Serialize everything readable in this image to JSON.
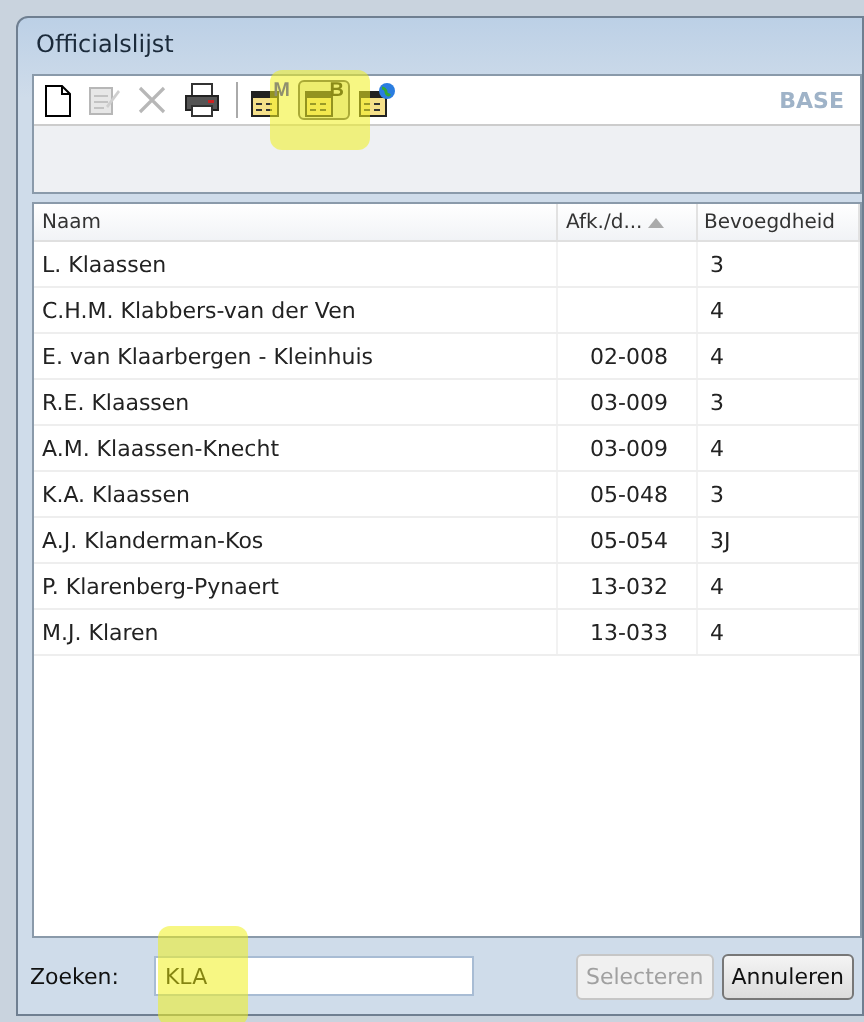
{
  "window": {
    "title": "Officialslijst"
  },
  "toolbar": {
    "buttons": [
      {
        "kind": "new",
        "disabled": false,
        "pressed": false
      },
      {
        "kind": "edit",
        "disabled": true,
        "pressed": false
      },
      {
        "kind": "delete",
        "disabled": true,
        "pressed": false
      },
      {
        "kind": "print",
        "disabled": false,
        "pressed": false
      },
      {
        "kind": "separator"
      },
      {
        "kind": "badge",
        "badge": "M",
        "pressed": false
      },
      {
        "kind": "badge",
        "badge": "B",
        "pressed": true
      },
      {
        "kind": "globe",
        "pressed": false
      }
    ],
    "label": "BASE"
  },
  "table": {
    "columns": [
      {
        "label": "Naam",
        "sorted": false
      },
      {
        "label": "Afk./d...",
        "sorted": true
      },
      {
        "label": "Bevoegdheid",
        "sorted": false
      }
    ],
    "rows": [
      [
        "L. Klaassen",
        "",
        "3"
      ],
      [
        "C.H.M. Klabbers-van der Ven",
        "",
        "4"
      ],
      [
        "E. van Klaarbergen - Kleinhuis",
        "02-008",
        "4"
      ],
      [
        "R.E. Klaassen",
        "03-009",
        "3"
      ],
      [
        "A.M. Klaassen-Knecht",
        "03-009",
        "4"
      ],
      [
        "K.A. Klaassen",
        "05-048",
        "3"
      ],
      [
        "A.J. Klanderman-Kos",
        "05-054",
        "3J"
      ],
      [
        "P. Klarenberg-Pynaert",
        "13-032",
        "4"
      ],
      [
        "M.J. Klaren",
        "13-033",
        "4"
      ]
    ]
  },
  "search": {
    "label": "Zoeken:",
    "value": "KLA"
  },
  "buttons": [
    {
      "label": "Selecteren",
      "disabled": true
    },
    {
      "label": "Annuleren",
      "disabled": false
    }
  ]
}
